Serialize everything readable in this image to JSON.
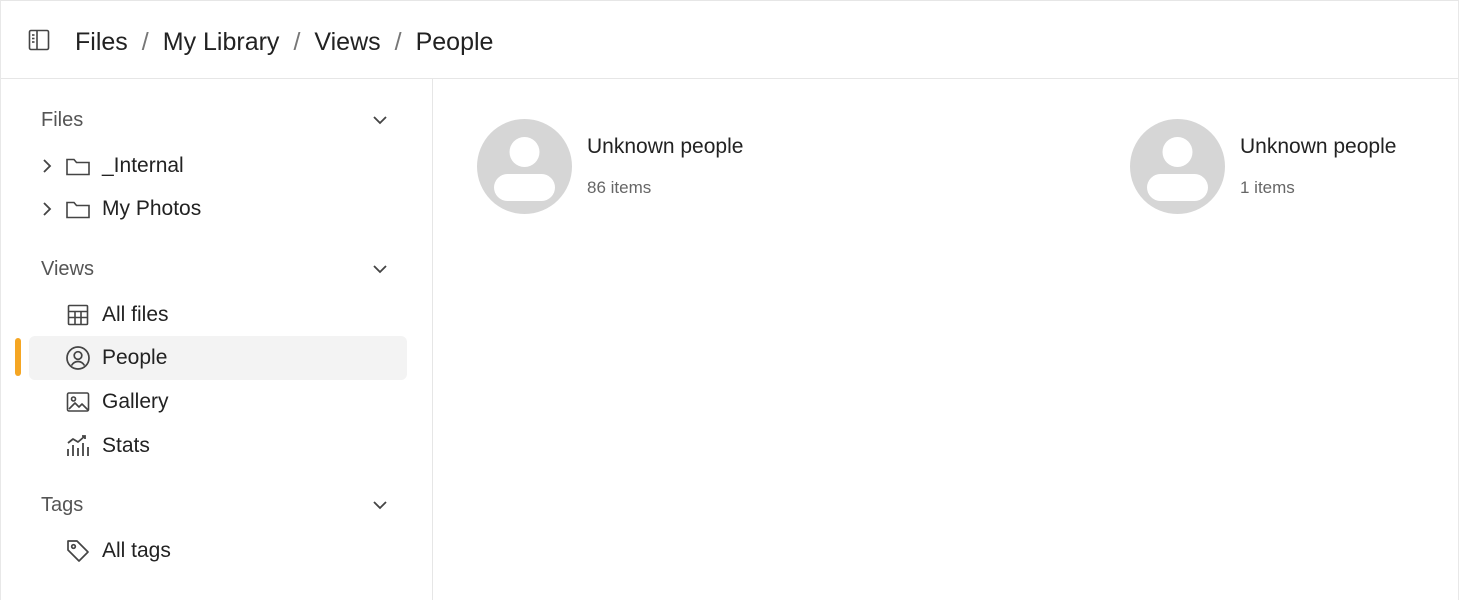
{
  "header": {
    "breadcrumb": [
      "Files",
      "My Library",
      "Views",
      "People"
    ],
    "separator": "/"
  },
  "sidebar": {
    "sections": {
      "files": {
        "title": "Files",
        "items": [
          {
            "label": "_Internal",
            "icon": "folder-icon"
          },
          {
            "label": "My Photos",
            "icon": "folder-icon"
          }
        ]
      },
      "views": {
        "title": "Views",
        "items": [
          {
            "label": "All files",
            "icon": "table-icon"
          },
          {
            "label": "People",
            "icon": "person-circle-icon",
            "active": true
          },
          {
            "label": "Gallery",
            "icon": "image-icon"
          },
          {
            "label": "Stats",
            "icon": "chart-icon"
          }
        ]
      },
      "tags": {
        "title": "Tags",
        "items": [
          {
            "label": "All tags",
            "icon": "tag-icon"
          }
        ]
      }
    }
  },
  "main": {
    "people": [
      {
        "name": "Unknown people",
        "count": "86 items"
      },
      {
        "name": "Unknown people",
        "count": "1 items"
      }
    ]
  },
  "colors": {
    "accent": "#f5a623",
    "avatar_bg": "#d6d6d6",
    "border": "#e6e6e6",
    "active_bg": "#f3f3f3"
  }
}
